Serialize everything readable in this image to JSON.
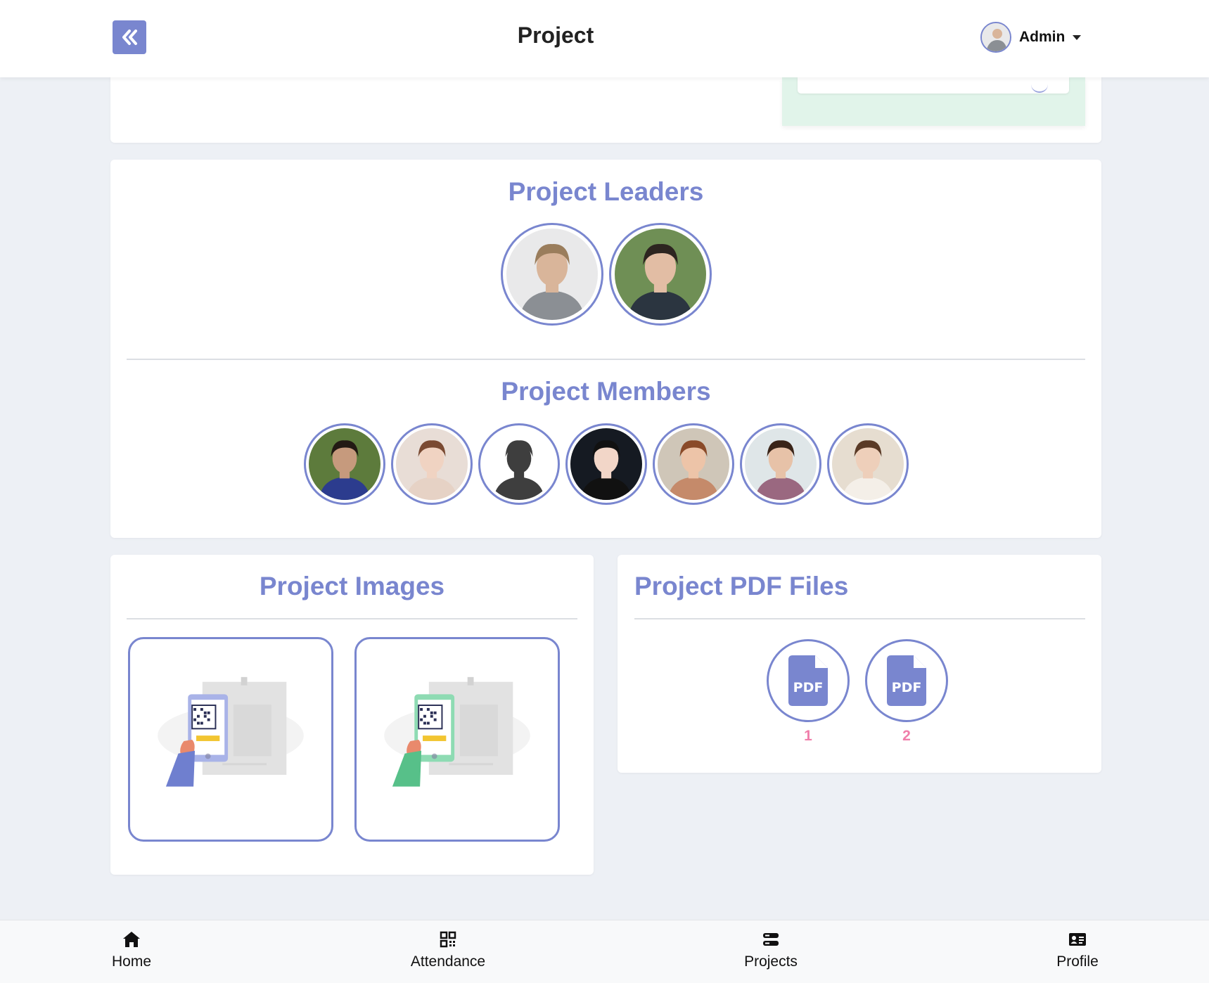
{
  "header": {
    "title": "Project",
    "user_name": "Admin",
    "back_icon": "double-chevron-left-icon",
    "accent": "#7986cf"
  },
  "team": {
    "leaders_title": "Project Leaders",
    "members_title": "Project Members",
    "leaders": [
      {
        "name": "leader-1",
        "skin": "#d9b59a",
        "hair": "#9a7d5c",
        "shirt": "#8b8f94",
        "bg": "#e9e9ea"
      },
      {
        "name": "leader-2",
        "skin": "#e2bda4",
        "hair": "#2d2520",
        "shirt": "#2b3540",
        "bg": "#6f8f55"
      }
    ],
    "members": [
      {
        "name": "member-1",
        "skin": "#c69a7d",
        "hair": "#231a14",
        "shirt": "#2c3c8e",
        "bg": "#5d7b3c"
      },
      {
        "name": "member-2",
        "skin": "#f0d3c2",
        "hair": "#7a4a32",
        "shirt": "#e6d2c5",
        "bg": "#e8ddd6"
      },
      {
        "name": "member-3",
        "skin": "#3e3e3e",
        "hair": "#3e3e3e",
        "shirt": "#3e3e3e",
        "bg": "#ffffff"
      },
      {
        "name": "member-4",
        "skin": "#f2d6c8",
        "hair": "#111111",
        "shirt": "#111111",
        "bg": "#151a22"
      },
      {
        "name": "member-5",
        "skin": "#edc4a8",
        "hair": "#8a4a28",
        "shirt": "#c58a6a",
        "bg": "#cfc6b8"
      },
      {
        "name": "member-6",
        "skin": "#e7c2a8",
        "hair": "#3a2418",
        "shirt": "#9a6880",
        "bg": "#dfe6e8"
      },
      {
        "name": "member-7",
        "skin": "#eecfba",
        "hair": "#5a3a26",
        "shirt": "#f4efe8",
        "bg": "#e6ddd0"
      }
    ]
  },
  "images": {
    "title": "Project Images",
    "items": [
      {
        "name": "image-1",
        "phone": "#a9b3e8",
        "sleeve": "#6f7fcf"
      },
      {
        "name": "image-2",
        "phone": "#8edbb3",
        "sleeve": "#57c089"
      }
    ]
  },
  "pdfs": {
    "title": "Project PDF Files",
    "icon": "pdf-file-icon",
    "label_color": "#f07eaa",
    "items": [
      {
        "label": "1"
      },
      {
        "label": "2"
      }
    ]
  },
  "nav": {
    "items": [
      {
        "label": "Home",
        "icon": "home-icon"
      },
      {
        "label": "Attendance",
        "icon": "qr-code-icon"
      },
      {
        "label": "Projects",
        "icon": "server-icon"
      },
      {
        "label": "Profile",
        "icon": "id-card-icon"
      }
    ]
  }
}
